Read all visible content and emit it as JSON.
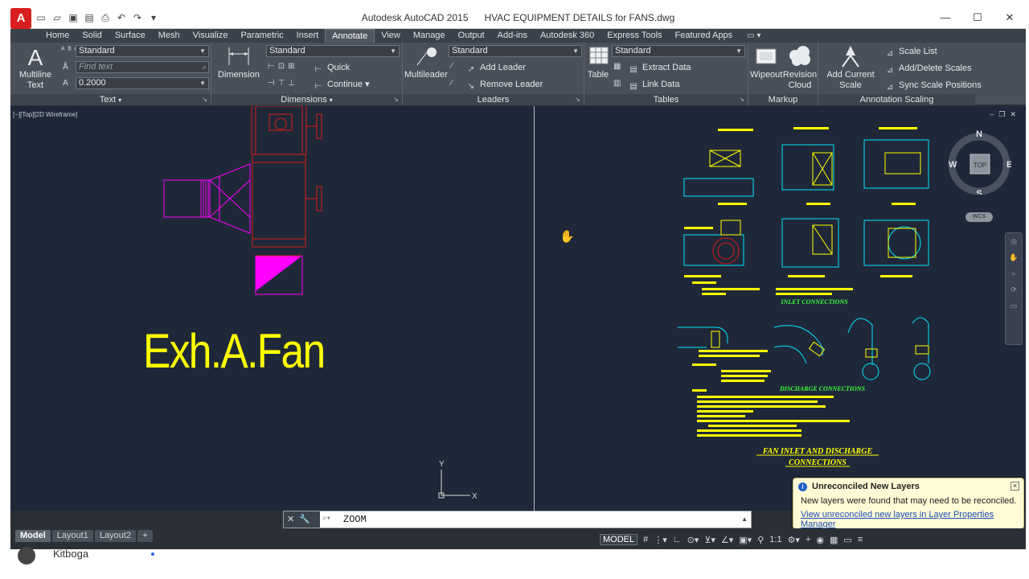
{
  "window": {
    "app_name": "Autodesk AutoCAD 2015",
    "file_name": "HVAC EQUIPMENT DETAILS for FANS.dwg",
    "logo_letter": "A"
  },
  "ribbon_tabs": [
    "Home",
    "Solid",
    "Surface",
    "Mesh",
    "Visualize",
    "Parametric",
    "Insert",
    "Annotate",
    "View",
    "Manage",
    "Output",
    "Add-ins",
    "Autodesk 360",
    "Express Tools",
    "Featured Apps"
  ],
  "active_tab": "Annotate",
  "text_panel": {
    "title": "Text",
    "multiline_label": "Multiline Text",
    "style_value": "Standard",
    "find_placeholder": "Find text",
    "height_value": "0.2000"
  },
  "dimensions_panel": {
    "title": "Dimensions",
    "dimension_label": "Dimension",
    "style_value": "Standard",
    "quick_label": "Quick",
    "continue_label": "Continue"
  },
  "leaders_panel": {
    "title": "Leaders",
    "multileader_label": "Multileader",
    "style_value": "Standard",
    "add_leader_label": "Add Leader",
    "remove_leader_label": "Remove Leader"
  },
  "tables_panel": {
    "title": "Tables",
    "table_label": "Table",
    "style_value": "Standard",
    "extract_label": "Extract Data",
    "link_label": "Link Data"
  },
  "markup_panel": {
    "title": "Markup",
    "wipeout_label": "Wipeout",
    "revision_cloud_label": "Revision Cloud"
  },
  "annotation_scaling_panel": {
    "title": "Annotation Scaling",
    "add_scale_label": "Add Current Scale",
    "scale_list_label": "Scale List",
    "add_delete_label": "Add/Delete Scales",
    "sync_label": "Sync Scale Positions"
  },
  "viewport": {
    "label": "[−][Top][2D Wireframe]",
    "fan_label": "Exh.A.Fan",
    "compass": {
      "n": "N",
      "s": "S",
      "e": "E",
      "w": "W",
      "top": "TOP"
    },
    "wcs_label": "WCS",
    "ucs_x": "X",
    "ucs_y": "Y",
    "detail_title_1": "FAN INLET AND DISCHARGE",
    "detail_title_2": "CONNECTIONS",
    "inlet_header": "INLET CONNECTIONS",
    "discharge_header": "DISCHARGE CONNECTIONS"
  },
  "notification": {
    "title": "Unreconciled New Layers",
    "message": "New layers were found that may need to be reconciled.",
    "link": "View unreconciled new layers in Layer Properties Manager"
  },
  "command_line": {
    "text": "ZOOM"
  },
  "layout_tabs": [
    "Model",
    "Layout1",
    "Layout2"
  ],
  "active_layout": "Model",
  "status_bar": {
    "model_label": "MODEL",
    "scale_label": "1:1"
  },
  "web_footer": {
    "user_name": "Kitboga"
  },
  "colors": {
    "canvas": "#1f2838",
    "fan_text": "#ffff00",
    "red_lines": "#d81b1b",
    "magenta": "#ff00ff",
    "cyan": "#00e5ff",
    "green_text": "#3cff3c"
  }
}
